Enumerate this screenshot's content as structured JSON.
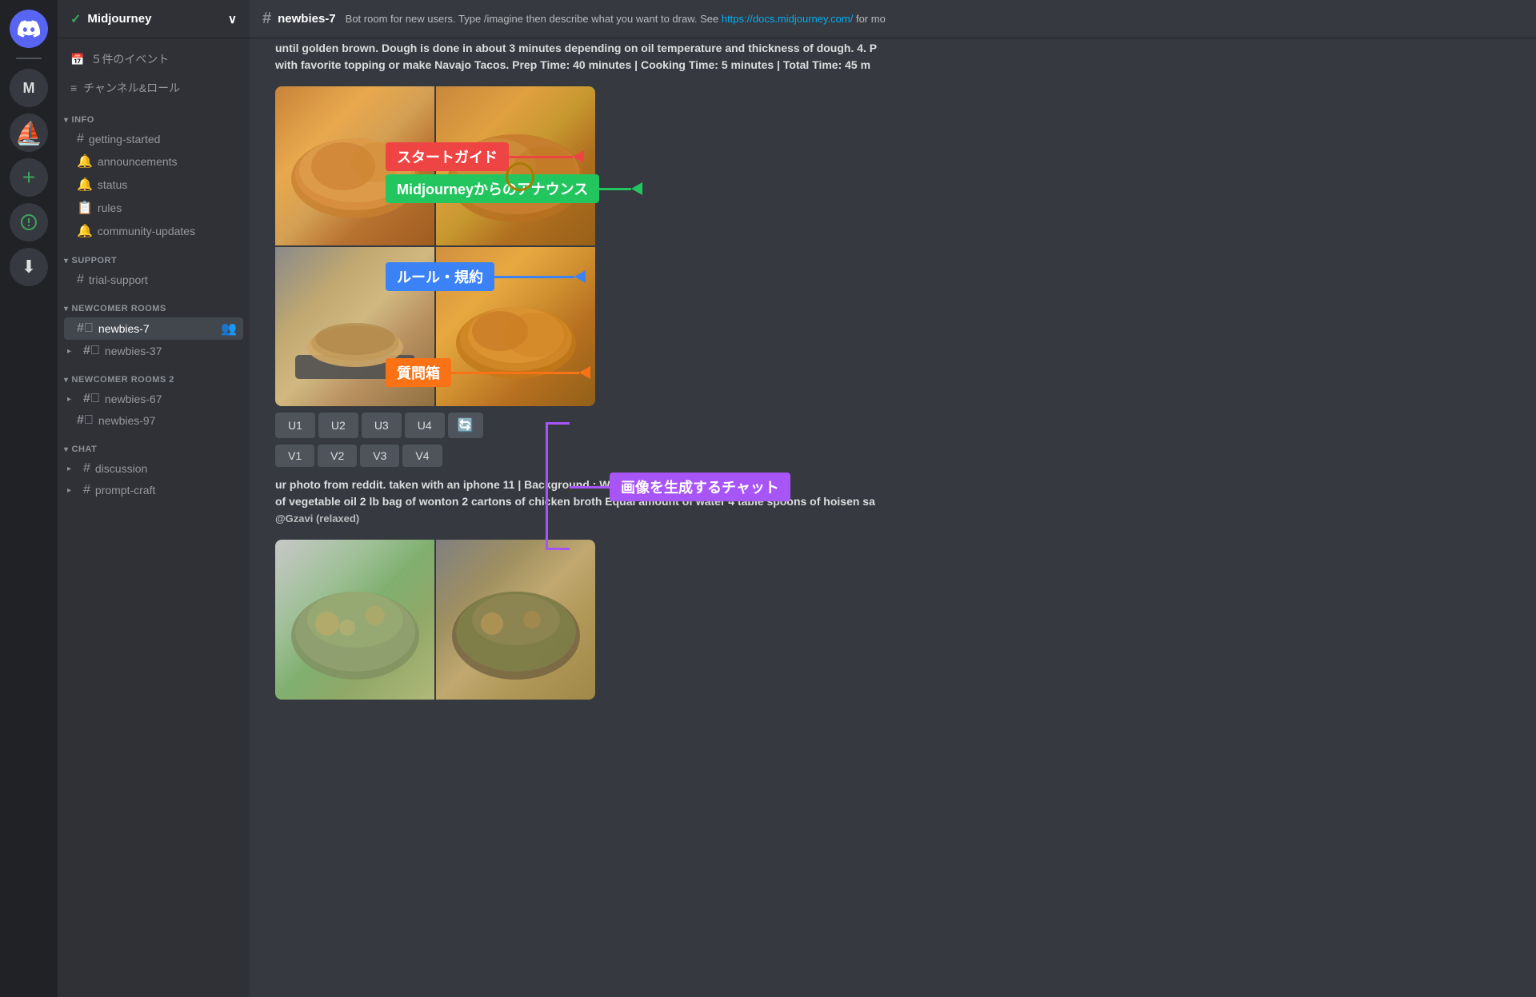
{
  "iconBar": {
    "discordIcon": "🎮",
    "serverM": "M",
    "addServer": "+",
    "exploreIcon": "🧭",
    "downloadIcon": "⬇"
  },
  "server": {
    "name": "Midjourney",
    "verified": true,
    "menuItems": [
      {
        "icon": "📅",
        "label": "５件のイベント"
      },
      {
        "icon": "≡",
        "label": "チャンネル&ロール"
      }
    ]
  },
  "categories": [
    {
      "name": "INFO",
      "channels": [
        {
          "type": "hash",
          "name": "getting-started",
          "active": false
        },
        {
          "type": "speaker",
          "name": "announcements",
          "active": false
        },
        {
          "type": "speaker",
          "name": "status",
          "active": false
        },
        {
          "type": "rules",
          "name": "rules",
          "active": false
        },
        {
          "type": "speaker",
          "name": "community-updates",
          "active": false
        }
      ]
    },
    {
      "name": "SUPPORT",
      "channels": [
        {
          "type": "hash",
          "name": "trial-support",
          "active": false
        }
      ]
    },
    {
      "name": "NEWCOMER ROOMS",
      "channels": [
        {
          "type": "hash-double",
          "name": "newbies-7",
          "active": true,
          "hasAddUser": true
        },
        {
          "type": "hash-double",
          "name": "newbies-37",
          "active": false,
          "collapsed": true
        }
      ]
    },
    {
      "name": "NEWCOMER ROOMS 2",
      "channels": [
        {
          "type": "hash-double",
          "name": "newbies-67",
          "active": false,
          "collapsed": true
        },
        {
          "type": "hash-double",
          "name": "newbies-97",
          "active": false
        }
      ]
    },
    {
      "name": "CHAT",
      "channels": [
        {
          "type": "hash",
          "name": "discussion",
          "active": false,
          "collapsed": true
        },
        {
          "type": "hash",
          "name": "prompt-craft",
          "active": false,
          "collapsed": true
        }
      ]
    }
  ],
  "topbar": {
    "channelName": "newbies-7",
    "description": "Bot room for new users. Type /imagine then describe what you want to draw. See ",
    "link": "https://docs.midjourney.com/",
    "linkText": "https://docs.midjourney.com/",
    "linkSuffix": " for mo"
  },
  "messages": {
    "text1": "until golden brown. Dough is done in about 3 minutes depending on oil temperature and thickness of dough. 4. P",
    "text1b": "with favorite topping or make Navajo Tacos. Prep Time: 40 minutes | Cooking Time: 5 minutes | Total Time: 45 m",
    "buttons": {
      "row1": [
        "U1",
        "U2",
        "U3",
        "U4"
      ],
      "row2": [
        "V1",
        "V2",
        "V3",
        "V4"
      ],
      "refresh": "🔄"
    },
    "text2": "ur photo from reddit. taken with an iphone 11 | Background : Wonton soup",
    "text2b": "of vegetable oil 2 lb bag of wonton 2 cartons of chicken broth Equal amount of water 4 table spoons of hoisen sa",
    "text2c": "@Gzavi (relaxed)"
  },
  "annotations": [
    {
      "id": "start-guide",
      "label": "スタートガイド",
      "color": "#ef4444",
      "arrowColor": "#ef4444",
      "direction": "left"
    },
    {
      "id": "announcements",
      "label": "MidjourneyからのアナウンスMidjourneyからのアナウンス",
      "labelShort": "Midjourneyからのアナウンス",
      "color": "#22c55e",
      "arrowColor": "#22c55e",
      "direction": "left"
    },
    {
      "id": "rules",
      "label": "ルール・規約",
      "color": "#3b82f6",
      "arrowColor": "#3b82f6",
      "direction": "left"
    },
    {
      "id": "trial-support",
      "label": "質問箱",
      "color": "#f97316",
      "arrowColor": "#f97316",
      "direction": "left"
    },
    {
      "id": "newbies-chat",
      "label": "画像を生成するチャット",
      "color": "#a855f7",
      "arrowColor": "#a855f7",
      "direction": "bracket"
    }
  ]
}
